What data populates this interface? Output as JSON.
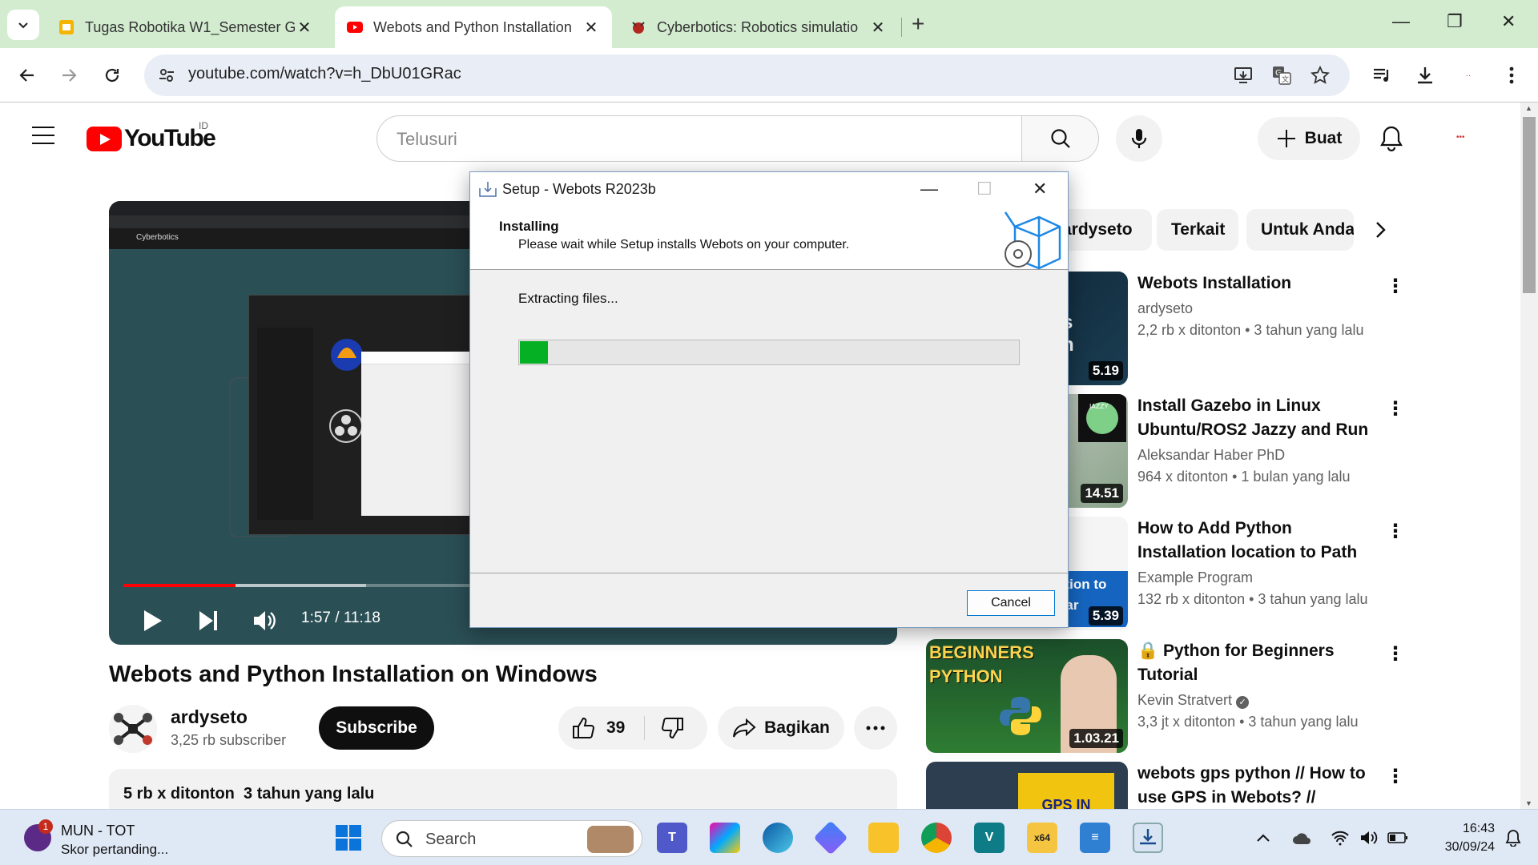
{
  "browser": {
    "tabs": [
      {
        "title": "Tugas Robotika W1_Semester G",
        "icon": "slides-icon"
      },
      {
        "title": "Webots and Python Installation",
        "icon": "youtube-icon",
        "active": true
      },
      {
        "title": "Cyberbotics: Robotics simulatio",
        "icon": "cyberbotics-icon"
      }
    ],
    "url": "youtube.com/watch?v=h_DbU01GRac"
  },
  "youtube": {
    "country": "ID",
    "search_placeholder": "Telusuri",
    "create_label": "Buat",
    "logo_text": "YouTube"
  },
  "player": {
    "current_time": "1:57",
    "duration": "11:18",
    "time_display": "1:57 / 11:18",
    "progress_played_fraction": 0.148,
    "buffered_fraction": 0.32,
    "inner_header": "Cyberbotics"
  },
  "video": {
    "title": "Webots and Python Installation on Windows",
    "channel": "ardyseto",
    "subscribers": "3,25 rb subscriber",
    "subscribe_label": "Subscribe",
    "likes": "39",
    "share_label": "Bagikan",
    "views": "5 rb x ditonton",
    "uploaded": "3 tahun yang lalu"
  },
  "chips": [
    "ardyseto",
    "Terkait",
    "Untuk Anda"
  ],
  "recommendations": [
    {
      "title": "Webots Installation",
      "channel": "ardyseto",
      "views": "2,2 rb x ditonton",
      "age": "3 tahun yang lalu",
      "duration": "5.19"
    },
    {
      "title": "Install Gazebo in Linux Ubuntu/ROS2 Jazzy and Run 3...",
      "channel": "Aleksandar Haber PhD",
      "views": "964 x ditonton",
      "age": "1 bulan yang lalu",
      "duration": "14.51"
    },
    {
      "title": "How to Add Python Installation location to Path Environment...",
      "channel": "Example Program",
      "views": "132 rb x ditonton",
      "age": "3 tahun yang lalu",
      "duration": "5.39",
      "thumb_text": "ation to\nVar"
    },
    {
      "title": "🔒 Python for Beginners Tutorial",
      "channel": "Kevin Stratvert",
      "views": "3,3 jt x ditonton",
      "age": "3 tahun yang lalu",
      "duration": "1.03.21",
      "thumb_text": "BEGINNERS\nPYTHON"
    },
    {
      "title": "webots gps python // How to use GPS in Webots? // Webots...",
      "channel": "",
      "views": "",
      "age": "",
      "duration": "",
      "thumb_text": "GPS IN"
    }
  ],
  "dialog": {
    "title": "Setup - Webots R2023b",
    "heading": "Installing",
    "subheading": "Please wait while Setup installs Webots on your computer.",
    "status": "Extracting files...",
    "progress_fraction": 0.06,
    "cancel_label": "Cancel"
  },
  "taskbar": {
    "widget_title": "MUN - TOT",
    "widget_sub": "Skor pertanding...",
    "widget_badge": "1",
    "search_placeholder": "Search",
    "time": "16:43",
    "date": "30/09/24",
    "apps": [
      "windows-start",
      "teams",
      "copilot",
      "edge",
      "app-blue",
      "file-explorer",
      "chrome",
      "vscode",
      "x64-app",
      "notepad",
      "installer"
    ]
  },
  "colors": {
    "tab_strip": "#d3ecd0",
    "yt_red": "#ff0000",
    "progress_green": "#06b025"
  }
}
